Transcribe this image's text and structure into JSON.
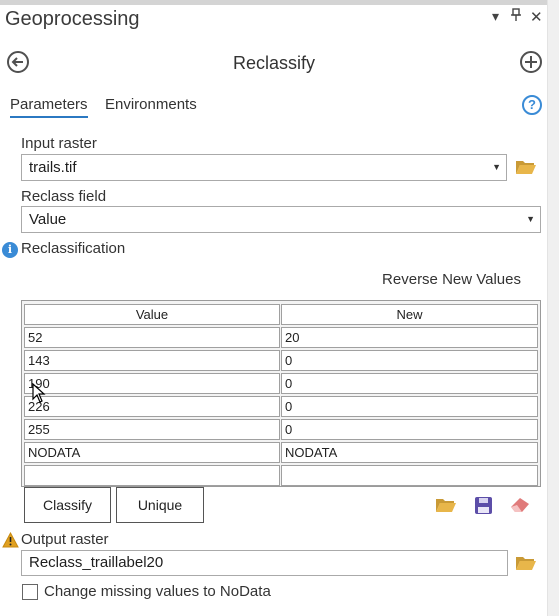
{
  "pane": {
    "title": "Geoprocessing",
    "menu_glyph": "▾",
    "pin_glyph": "📌",
    "close_glyph": "✕"
  },
  "tool": {
    "title": "Reclassify"
  },
  "tabs": [
    {
      "label": "Parameters"
    },
    {
      "label": "Environments"
    }
  ],
  "help_glyph": "?",
  "input_raster": {
    "label": "Input raster",
    "value": "trails.tif"
  },
  "reclass_field": {
    "label": "Reclass field",
    "value": "Value"
  },
  "reclassification": {
    "label": "Reclassification",
    "reverse_label": "Reverse New Values",
    "columns": [
      "Value",
      "New"
    ],
    "rows": [
      [
        "52",
        "20"
      ],
      [
        "143",
        "0"
      ],
      [
        "190",
        "0"
      ],
      [
        "226",
        "0"
      ],
      [
        "255",
        "0"
      ],
      [
        "NODATA",
        "NODATA"
      ],
      [
        "",
        ""
      ]
    ],
    "classify_label": "Classify",
    "unique_label": "Unique"
  },
  "output_raster": {
    "label": "Output raster",
    "value": "Reclass_traillabel20"
  },
  "missing_values": {
    "label": "Change missing values to NoData",
    "checked": false
  },
  "colors": {
    "accent": "#2b79c2",
    "folder": "#d9a43a",
    "save": "#5c4ea8",
    "eraser": "#e07a7a",
    "warning": "#e0a020"
  }
}
